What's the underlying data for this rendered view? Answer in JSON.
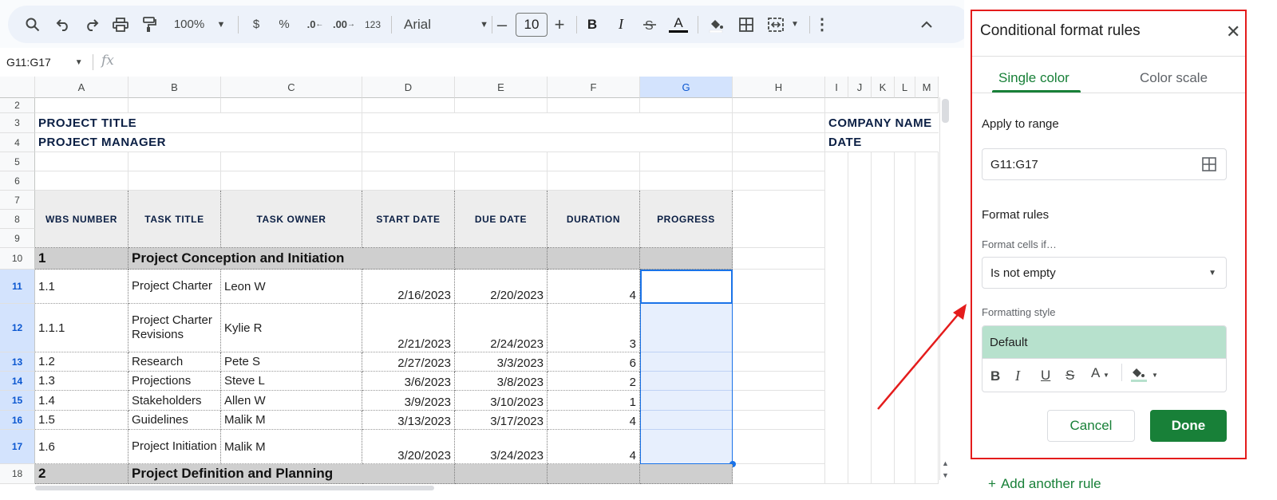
{
  "toolbar": {
    "zoom": "100%",
    "currency": "$",
    "percent": "%",
    "dec_less": ".0",
    "dec_more": ".00",
    "format_123": "123",
    "font": "Arial",
    "font_size": "10",
    "bold": "B",
    "italic": "I",
    "text_color": "A"
  },
  "formula_bar": {
    "name_box": "G11:G17",
    "fx": "fx"
  },
  "columns": [
    "A",
    "B",
    "C",
    "D",
    "E",
    "F",
    "G",
    "H",
    "I",
    "J",
    "K",
    "L",
    "M"
  ],
  "rows": {
    "r2": "2",
    "r3": "3",
    "r4": "4",
    "r5": "5",
    "r6": "6",
    "r7": "7",
    "r8": "8",
    "r9": "9",
    "r10": "10",
    "r11": "11",
    "r12": "12",
    "r13": "13",
    "r14": "14",
    "r15": "15",
    "r16": "16",
    "r17": "17",
    "r18": "18"
  },
  "sheet": {
    "project_title": "PROJECT TITLE",
    "project_manager": "PROJECT MANAGER",
    "company_name": "COMPANY NAME",
    "date": "DATE",
    "headers": {
      "wbs": "WBS NUMBER",
      "task": "TASK TITLE",
      "owner": "TASK OWNER",
      "start": "START DATE",
      "due": "DUE DATE",
      "duration": "DURATION",
      "progress": "PROGRESS"
    },
    "phase1": {
      "num": "1",
      "title": "Project Conception and Initiation"
    },
    "phase2": {
      "num": "2",
      "title": "Project Definition and Planning"
    },
    "tasks": [
      {
        "wbs": "1.1",
        "title": "Project Charter",
        "owner": "Leon W",
        "start": "2/16/2023",
        "due": "2/20/2023",
        "duration": "4"
      },
      {
        "wbs": "1.1.1",
        "title": "Project Charter Revisions",
        "owner": "Kylie R",
        "start": "2/21/2023",
        "due": "2/24/2023",
        "duration": "3"
      },
      {
        "wbs": "1.2",
        "title": "Research",
        "owner": "Pete S",
        "start": "2/27/2023",
        "due": "3/3/2023",
        "duration": "6"
      },
      {
        "wbs": "1.3",
        "title": "Projections",
        "owner": "Steve L",
        "start": "3/6/2023",
        "due": "3/8/2023",
        "duration": "2"
      },
      {
        "wbs": "1.4",
        "title": "Stakeholders",
        "owner": "Allen W",
        "start": "3/9/2023",
        "due": "3/10/2023",
        "duration": "1"
      },
      {
        "wbs": "1.5",
        "title": "Guidelines",
        "owner": "Malik M",
        "start": "3/13/2023",
        "due": "3/17/2023",
        "duration": "4"
      },
      {
        "wbs": "1.6",
        "title": "Project Initiation",
        "owner": "Malik M",
        "start": "3/20/2023",
        "due": "3/24/2023",
        "duration": "4"
      }
    ]
  },
  "panel": {
    "title": "Conditional format rules",
    "tab_single": "Single color",
    "tab_scale": "Color scale",
    "apply_label": "Apply to range",
    "range_value": "G11:G17",
    "rules_label": "Format rules",
    "cells_if_label": "Format cells if…",
    "condition": "Is not empty",
    "style_label": "Formatting style",
    "style_preview": "Default",
    "style_bold": "B",
    "style_italic": "I",
    "style_underline": "U",
    "style_strike": "S",
    "style_text_color": "A",
    "cancel": "Cancel",
    "done": "Done",
    "add_rule": "Add another rule"
  },
  "colors": {
    "accent_green": "#188038",
    "highlight_red": "#e41c1c",
    "selection_blue": "#d3e3fd",
    "style_preview_bg": "#b7e1cd"
  }
}
